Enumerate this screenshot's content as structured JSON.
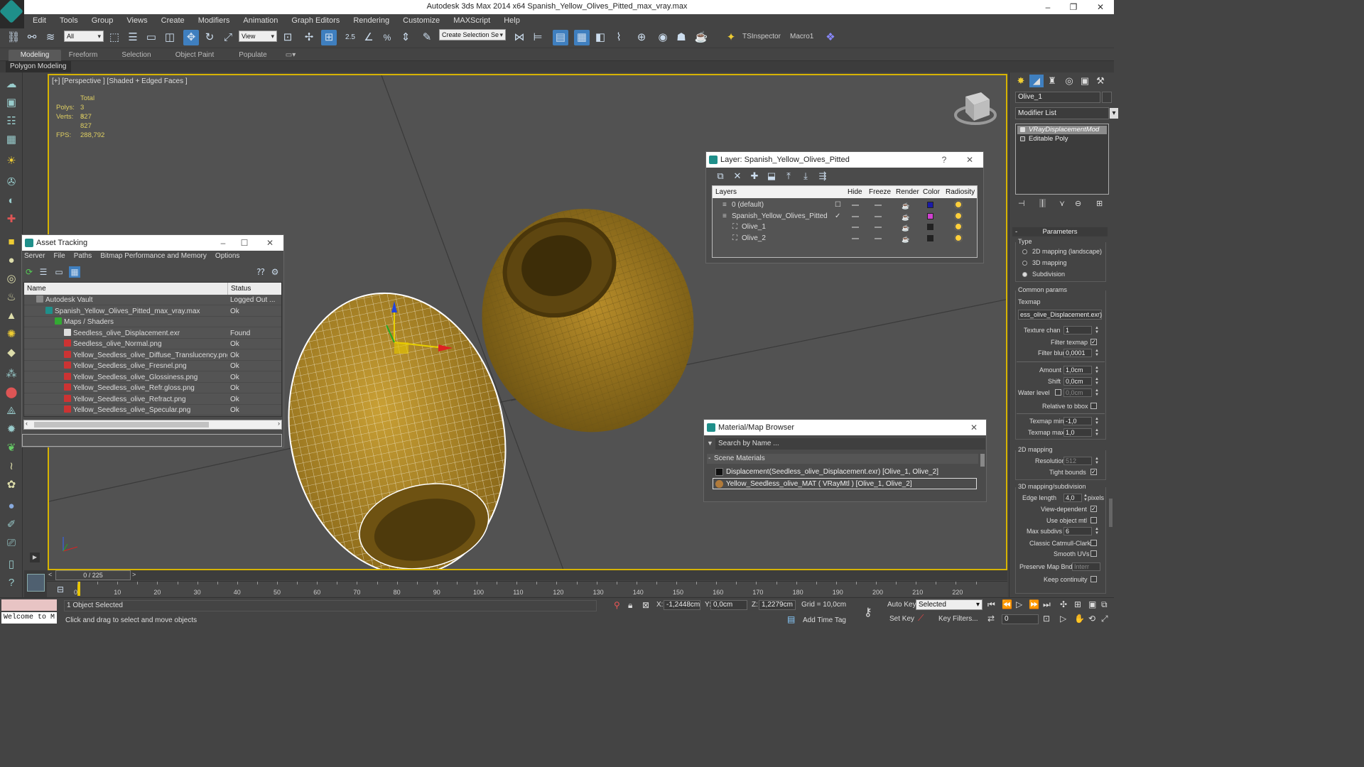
{
  "window": {
    "title": "Autodesk 3ds Max  2014 x64     Spanish_Yellow_Olives_Pitted_max_vray.max",
    "minimize": "–",
    "restore": "❐",
    "close": "✕"
  },
  "menu": [
    "Edit",
    "Tools",
    "Group",
    "Views",
    "Create",
    "Modifiers",
    "Animation",
    "Graph Editors",
    "Rendering",
    "Customize",
    "MAXScript",
    "Help"
  ],
  "toolbar": {
    "filter": "All",
    "ref_coord": "View",
    "snap_angle": "2.5",
    "selection_set": "Create Selection Se",
    "tsinspector": "TSInspector",
    "macro": "Macro1"
  },
  "ribbon": {
    "tabs": [
      "Modeling",
      "Freeform",
      "Selection",
      "Object Paint",
      "Populate"
    ],
    "active": "Modeling",
    "sub": "Polygon Modeling"
  },
  "viewport": {
    "label": "[+] [Perspective ] [Shaded + Edged Faces ]",
    "stats": {
      "total_label": "Total",
      "polys_label": "Polys:",
      "polys": "3 827",
      "verts_label": "Verts:",
      "verts": "3 827",
      "fps_label": "FPS:",
      "fps": "288,792"
    }
  },
  "asset_tracking": {
    "title": "Asset Tracking",
    "menu": [
      "Server",
      "File",
      "Paths",
      "Bitmap Performance and Memory",
      "Options"
    ],
    "columns": [
      "Name",
      "Status"
    ],
    "rows": [
      {
        "name": "Autodesk Vault",
        "status": "Logged Out ...",
        "indent": 1,
        "icon": "vault"
      },
      {
        "name": "Spanish_Yellow_Olives_Pitted_max_vray.max",
        "status": "Ok",
        "indent": 2,
        "icon": "max"
      },
      {
        "name": "Maps / Shaders",
        "status": "",
        "indent": 3,
        "icon": "maps"
      },
      {
        "name": "Seedless_olive_Displacement.exr",
        "status": "Found",
        "indent": 4,
        "icon": "exr"
      },
      {
        "name": "Seedless_olive_Normal.png",
        "status": "Ok",
        "indent": 4,
        "icon": "png"
      },
      {
        "name": "Yellow_Seedless_olive_Diffuse_Translucency.png",
        "status": "Ok",
        "indent": 4,
        "icon": "png"
      },
      {
        "name": "Yellow_Seedless_olive_Fresnel.png",
        "status": "Ok",
        "indent": 4,
        "icon": "png"
      },
      {
        "name": "Yellow_Seedless_olive_Glossiness.png",
        "status": "Ok",
        "indent": 4,
        "icon": "png"
      },
      {
        "name": "Yellow_Seedless_olive_Refr.gloss.png",
        "status": "Ok",
        "indent": 4,
        "icon": "png"
      },
      {
        "name": "Yellow_Seedless_olive_Refract.png",
        "status": "Ok",
        "indent": 4,
        "icon": "png"
      },
      {
        "name": "Yellow_Seedless_olive_Specular.png",
        "status": "Ok",
        "indent": 4,
        "icon": "png"
      }
    ]
  },
  "layer_window": {
    "title": "Layer: Spanish_Yellow_Olives_Pitted",
    "help": "?",
    "columns": [
      "Layers",
      "Hide",
      "Freeze",
      "Render",
      "Color",
      "Radiosity"
    ],
    "rows": [
      {
        "name": "0 (default)",
        "indent": 0,
        "color": "#1a1aa8"
      },
      {
        "name": "Spanish_Yellow_Olives_Pitted",
        "indent": 0,
        "color": "#d040d0"
      },
      {
        "name": "Olive_1",
        "indent": 1,
        "color": "#222222"
      },
      {
        "name": "Olive_2",
        "indent": 1,
        "color": "#222222"
      }
    ]
  },
  "material_browser": {
    "title": "Material/Map Browser",
    "search_placeholder": "Search by Name ...",
    "section": "Scene Materials",
    "items": [
      {
        "label": "Displacement(Seedless_olive_Displacement.exr) [Olive_1, Olive_2]",
        "selected": false
      },
      {
        "label": "Yellow_Seedless_olive_MAT  ( VRayMtl ) [Olive_1, Olive_2]",
        "selected": true
      }
    ]
  },
  "command_panel": {
    "object_name": "Olive_1",
    "modifier_list": "Modifier List",
    "stack": [
      "VRayDisplacementMod",
      "Editable Poly"
    ],
    "rollout": "Parameters",
    "type_label": "Type",
    "type_options": [
      "2D mapping (landscape)",
      "3D mapping",
      "Subdivision"
    ],
    "type_selected": 2,
    "common_params": "Common params",
    "texmap_label": "Texmap",
    "texmap_value": "ess_olive_Displacement.exr)",
    "texture_chan_label": "Texture chan",
    "texture_chan": "1",
    "filter_texmap_label": "Filter texmap",
    "filter_blur_label": "Filter blur",
    "filter_blur": "0,0001",
    "amount_label": "Amount",
    "amount": "1,0cm",
    "shift_label": "Shift",
    "shift": "0,0cm",
    "water_label": "Water level",
    "water": "0,0cm",
    "relative_label": "Relative to bbox",
    "texmap_min_label": "Texmap min",
    "texmap_min": "-1,0",
    "texmap_max_label": "Texmap max",
    "texmap_max": "1,0",
    "mapping2d": "2D mapping",
    "resolution_label": "Resolution",
    "resolution": "512",
    "tight_label": "Tight bounds",
    "mapping3d": "3D mapping/subdivision",
    "edge_label": "Edge length",
    "edge": "4,0",
    "pixels": "pixels",
    "viewdep_label": "View-dependent",
    "useobj_label": "Use object mtl",
    "maxsub_label": "Max subdivs",
    "maxsub": "6",
    "catmull_label": "Classic Catmull-Clark",
    "smoothuv_label": "Smooth UVs",
    "preserve_label": "Preserve Map Bnd",
    "preserve": "Interr",
    "keepcont_label": "Keep continuity"
  },
  "timeline": {
    "slider": "0 / 225",
    "ticks": [
      "0",
      "10",
      "20",
      "30",
      "40",
      "50",
      "60",
      "70",
      "80",
      "90",
      "100",
      "110",
      "120",
      "130",
      "140",
      "150",
      "160",
      "170",
      "180",
      "190",
      "200",
      "210",
      "220"
    ]
  },
  "status": {
    "welcome": "Welcome to M",
    "selected": "1 Object Selected",
    "prompt": "Click and drag to select and move objects",
    "x_label": "X:",
    "x": "-1,2448cm",
    "y_label": "Y:",
    "y": "0,0cm",
    "z_label": "Z:",
    "z": "1,2279cm",
    "grid": "Grid = 10,0cm",
    "add_time_tag": "Add Time Tag",
    "auto_key": "Auto Key",
    "key_mode": "Selected",
    "set_key": "Set Key",
    "key_filters": "Key Filters...",
    "frame": "0"
  }
}
